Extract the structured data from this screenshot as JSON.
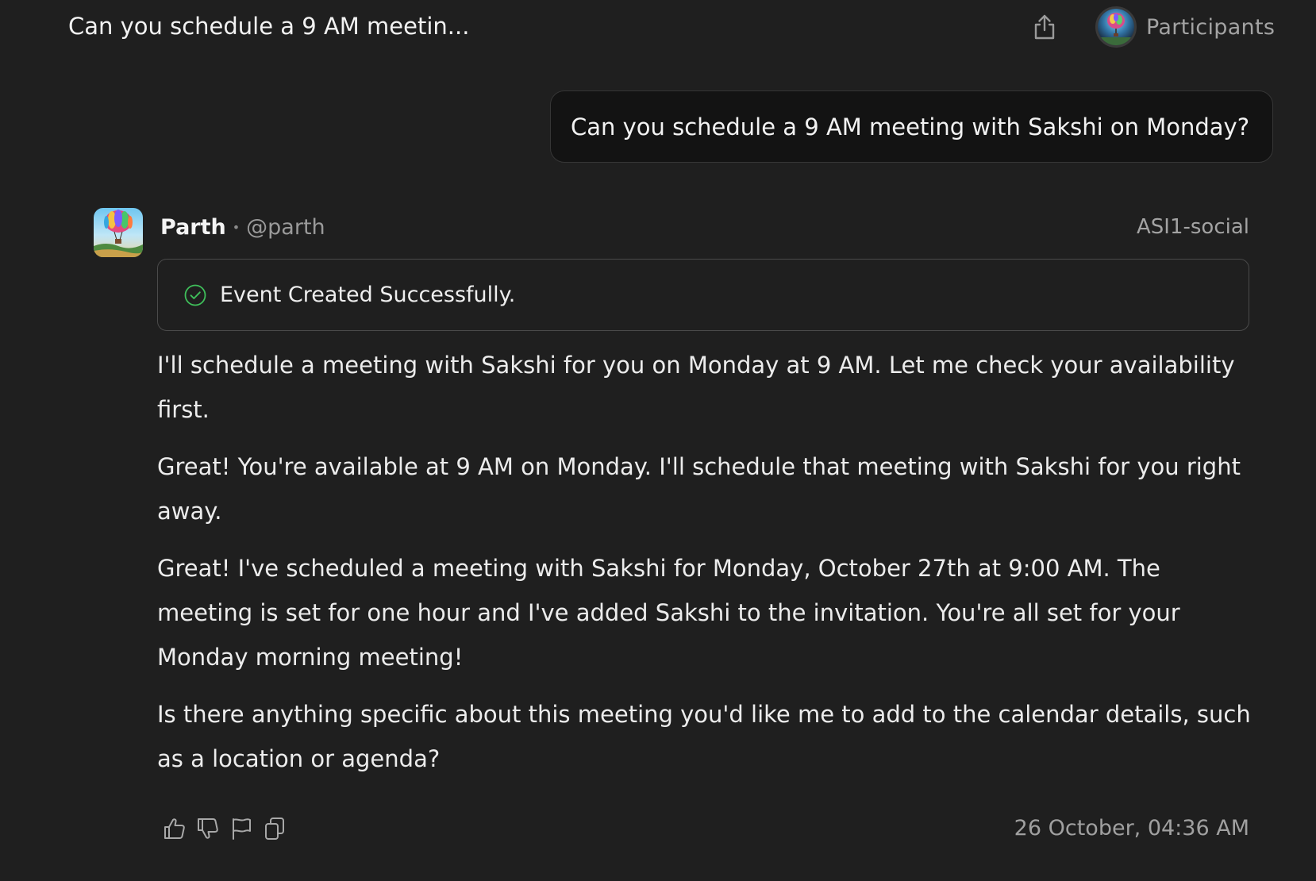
{
  "header": {
    "title": "Can you schedule a 9 AM meetin...",
    "share_icon": "share-icon",
    "participants_label": "Participants"
  },
  "user_message": {
    "text": "Can you schedule a 9 AM meeting with Sakshi on Monday?"
  },
  "assistant": {
    "name": "Parth",
    "separator": "•",
    "handle": "@parth",
    "model": "ASI1-social",
    "event_status": {
      "icon": "check-circle-icon",
      "text": "Event Created Successfully.",
      "color": "#3fbf5a"
    },
    "paragraphs": [
      "I'll schedule a meeting with Sakshi for you on Monday at 9 AM. Let me check your availability first.",
      "Great! You're available at 9 AM on Monday. I'll schedule that meeting with Sakshi for you right away.",
      "Great! I've scheduled a meeting with Sakshi for Monday, October 27th at 9:00 AM. The meeting is set for one hour and I've added Sakshi to the invitation. You're all set for your Monday morning meeting!",
      "Is there anything specific about this meeting you'd like me to add to the calendar details, such as a location or agenda?"
    ],
    "actions": [
      {
        "icon": "thumbs-up-icon"
      },
      {
        "icon": "thumbs-down-icon"
      },
      {
        "icon": "flag-icon"
      },
      {
        "icon": "copy-icon"
      }
    ],
    "timestamp": "26 October, 04:36 AM"
  },
  "colors": {
    "background": "#1f1f1f",
    "user_bubble": "#131313",
    "text_primary": "#ececec",
    "text_muted": "#a3a3a3",
    "success": "#3fbf5a"
  }
}
